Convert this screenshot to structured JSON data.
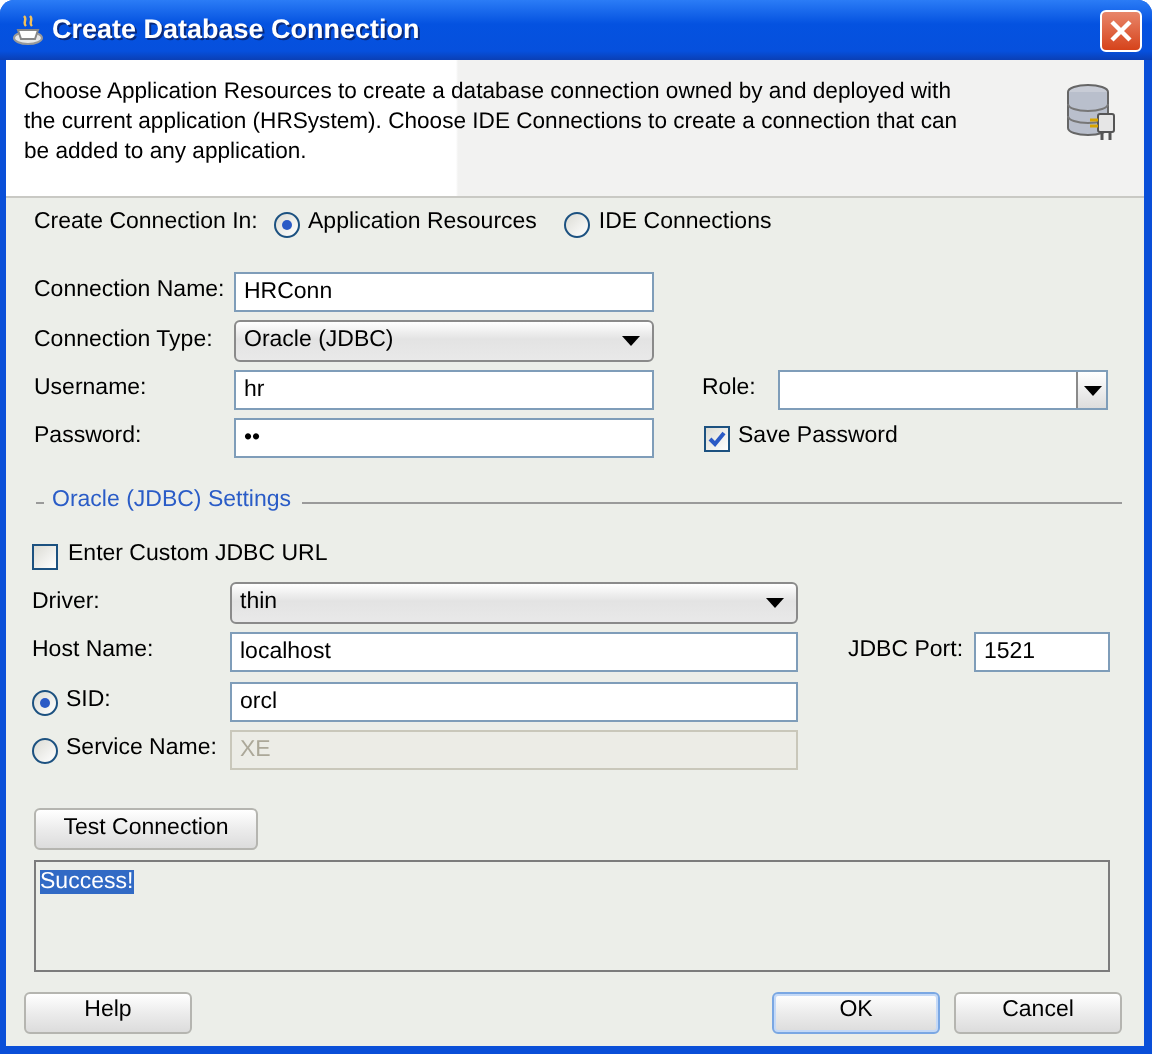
{
  "window": {
    "title": "Create Database Connection"
  },
  "header": {
    "description": "Choose Application Resources to create a database connection owned by and deployed with the current application (HRSystem). Choose IDE Connections to create a connection that can be added to any application."
  },
  "create_in": {
    "label": "Create Connection In:",
    "options": [
      {
        "label": "Application Resources",
        "selected": true
      },
      {
        "label": "IDE Connections",
        "selected": false
      }
    ]
  },
  "connection_name": {
    "label": "Connection Name:",
    "value": "HRConn"
  },
  "connection_type": {
    "label": "Connection Type:",
    "value": "Oracle (JDBC)"
  },
  "username": {
    "label": "Username:",
    "value": "hr"
  },
  "role": {
    "label": "Role:"
  },
  "password": {
    "label": "Password:",
    "value": "••"
  },
  "save_password": {
    "label": "Save Password",
    "checked": true
  },
  "settings": {
    "title": "Oracle (JDBC) Settings",
    "custom_url": {
      "label": "Enter Custom JDBC URL",
      "checked": false
    },
    "driver": {
      "label": "Driver:",
      "value": "thin"
    },
    "host_name": {
      "label": "Host Name:",
      "value": "localhost"
    },
    "jdbc_port": {
      "label": "JDBC Port:",
      "value": "1521"
    },
    "id_options": [
      {
        "label": "SID:",
        "value": "orcl",
        "selected": true
      },
      {
        "label": "Service Name:",
        "value": "XE",
        "selected": false
      }
    ]
  },
  "test_button": {
    "label": "Test Connection"
  },
  "output": {
    "text": "Success!",
    "highlighted": true
  },
  "buttons": [
    {
      "label": "Help",
      "default": false
    },
    {
      "label": "OK",
      "default": true
    },
    {
      "label": "Cancel",
      "default": false
    }
  ]
}
